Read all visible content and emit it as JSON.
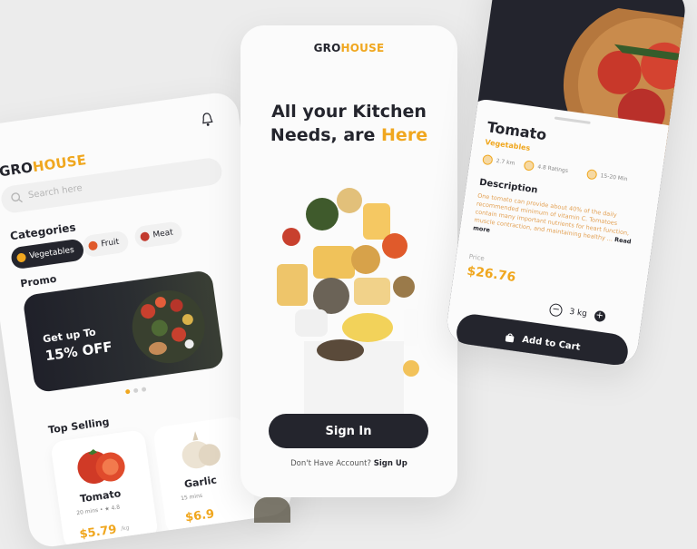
{
  "brand": {
    "part1": "GRO",
    "part2": "HOUSE"
  },
  "left": {
    "search_placeholder": "Search here",
    "categories_title": "Categories",
    "categories": [
      {
        "label": "Vegetables",
        "active": true
      },
      {
        "label": "Fruit",
        "active": false
      },
      {
        "label": "Meat",
        "active": false
      }
    ],
    "promo_title": "Promo",
    "promo_line1": "Get up To",
    "promo_line2": "15% OFF",
    "top_selling_title": "Top Selling",
    "products": [
      {
        "name": "Tomato",
        "meta": "20 mins • ★ 4.8",
        "price": "$5.79",
        "unit": "/kg"
      },
      {
        "name": "Garlic",
        "meta": "15 mins",
        "price": "$6.9"
      }
    ]
  },
  "center": {
    "headline_line1": "All your Kitchen",
    "headline_line2_a": "Needs, are ",
    "headline_line2_b": "Here",
    "signin_label": "Sign In",
    "no_account": "Don't Have Account?",
    "signup_label": "Sign Up"
  },
  "right": {
    "name": "Tomato",
    "category": "Vegetables",
    "distance": "2.7 km",
    "ratings": "4.8 Ratings",
    "time": "15-20 Min",
    "description_title": "Description",
    "description": "One tomato can provide about 40% of the daily recommended minimum of vitamin C. Tomatoes contain many important nutrients for heart function, muscle contraction, and maintaining healthy ... ",
    "read_more": "Read more",
    "price_label": "Price",
    "price": "$26.76",
    "quantity": "3 kg",
    "add_to_cart": "Add to Cart"
  },
  "colors": {
    "accent": "#f0a71f",
    "dark": "#24252d",
    "background": "#ececec"
  }
}
